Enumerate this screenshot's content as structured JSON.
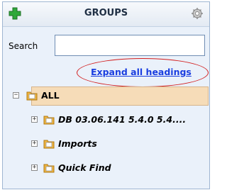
{
  "header": {
    "title": "GROUPS",
    "add_icon": "green-plus-icon",
    "settings_icon": "gear-icon"
  },
  "search": {
    "label": "Search",
    "value": "",
    "placeholder": ""
  },
  "expand_link": "Expand all headings",
  "tree": {
    "root": {
      "label": "ALL",
      "toggle": "−"
    },
    "children": [
      {
        "label": "DB  03.06.141  5.4.0  5.4....",
        "toggle": "+"
      },
      {
        "label": "Imports",
        "toggle": "+"
      },
      {
        "label": "Quick Find",
        "toggle": "+"
      }
    ]
  },
  "colors": {
    "accent_link": "#1a3ee0",
    "highlight": "#d21d1d",
    "selected_row": "#f6dcb8"
  }
}
